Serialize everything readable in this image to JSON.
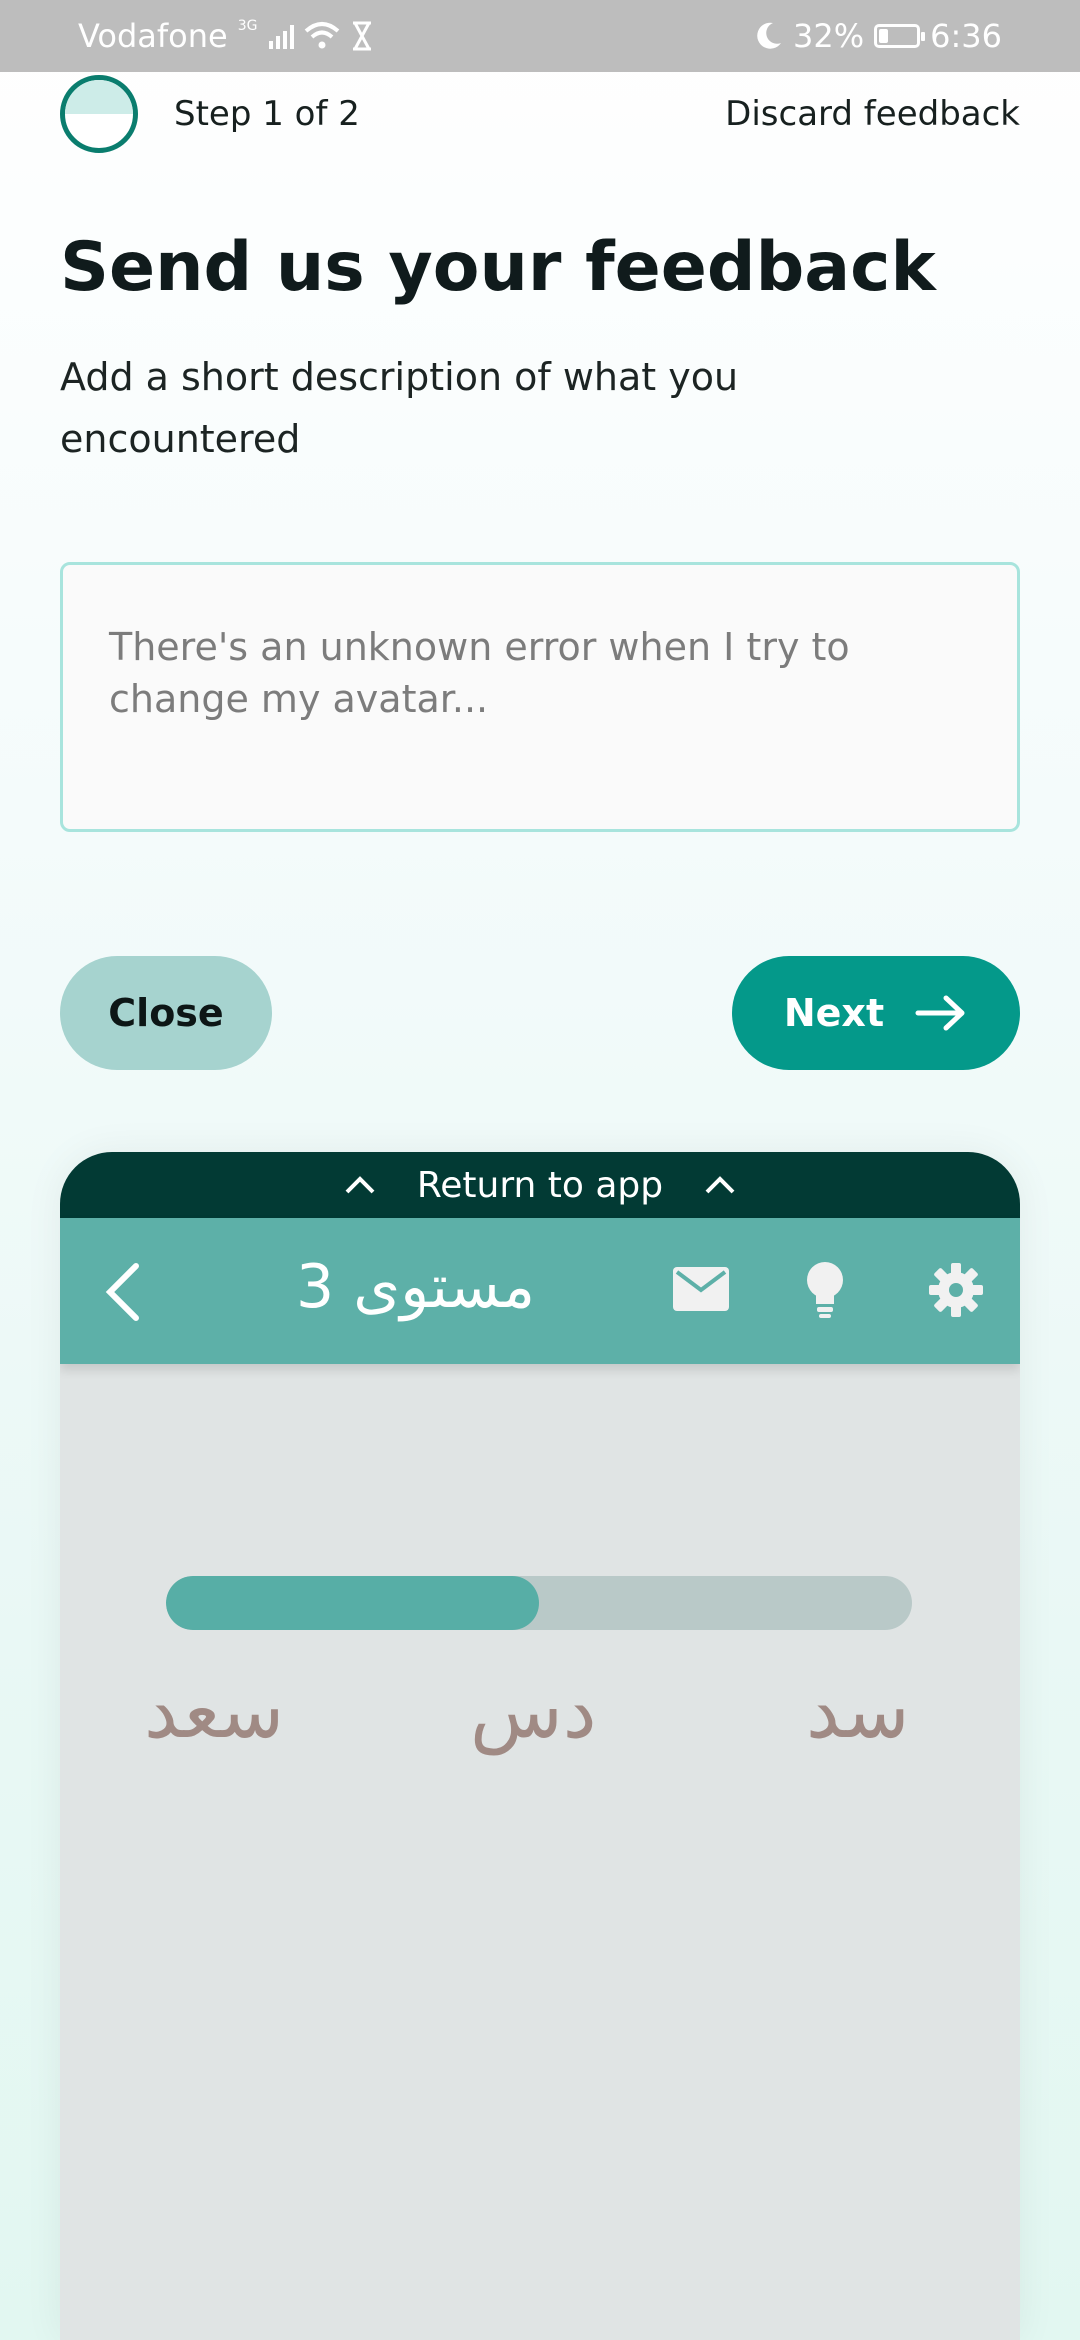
{
  "status_bar": {
    "carrier": "Vodafone",
    "network": "3G",
    "battery": "32%",
    "battery_level": 0.32,
    "time": "6:36"
  },
  "header": {
    "step_text": "Step 1 of 2",
    "discard_label": "Discard feedback",
    "step_progress": 0.5
  },
  "main": {
    "title": "Send us your feedback",
    "description": "Add a short description of what you encountered",
    "input_placeholder": "There's an unknown error when I try to change my avatar...",
    "input_value": ""
  },
  "actions": {
    "close_label": "Close",
    "next_label": "Next"
  },
  "preview": {
    "return_label": "Return to app",
    "app_title": "مستوى 3",
    "progress": 0.5,
    "words": [
      "سعد",
      "دس",
      "سد"
    ],
    "colors": {
      "return_bar": "#023a34",
      "toolbar": "#5db0a8",
      "progress_fill": "#57aea6",
      "progress_track": "#b9c9c8",
      "word": "#a08a84"
    }
  },
  "colors": {
    "accent": "#04998a",
    "close_button": "#a6d3cf",
    "input_border": "#a8e4dd"
  },
  "icons": {
    "back": "chevron-left-icon",
    "mail": "mail-icon",
    "bulb": "lightbulb-icon",
    "settings": "gear-icon",
    "next": "arrow-right-icon",
    "return": "chevron-up-icon"
  }
}
